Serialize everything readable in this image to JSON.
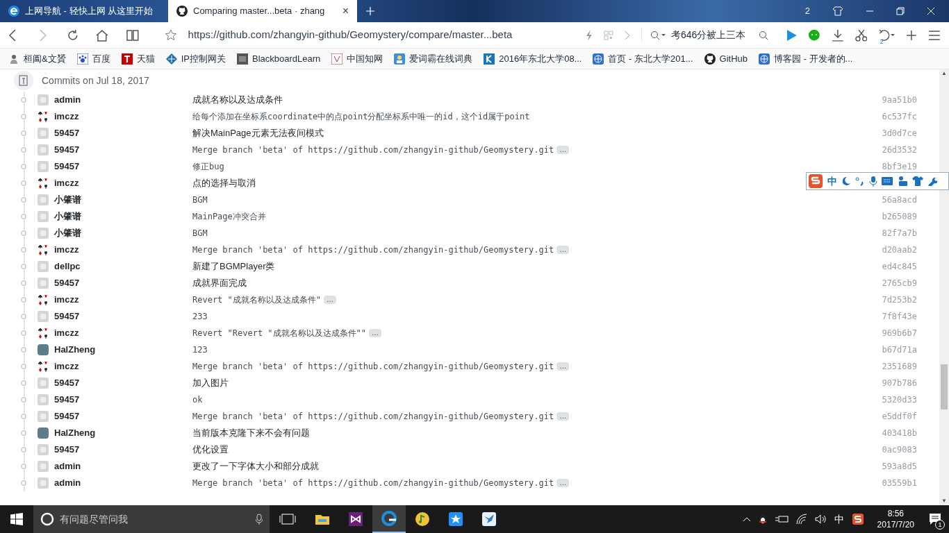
{
  "tabs": [
    {
      "label": "上网导航 - 轻快上网 从这里开始",
      "selected": false
    },
    {
      "label": "Comparing master...beta · zhang",
      "selected": true,
      "close_label": "×"
    }
  ],
  "scroll_arrows": {
    "up": "▲",
    "down": "▼"
  },
  "window_badge": "2",
  "address": {
    "url": "https://github.com/zhangyin-github/Geomystery/compare/master...beta",
    "search": "考646分被上三本",
    "undo_count": "2"
  },
  "bookmarks": [
    {
      "label": "桓阖&文贇",
      "kind": "person"
    },
    {
      "label": "百度",
      "kind": "paw"
    },
    {
      "label": "天猫",
      "kind": "t"
    },
    {
      "label": "IP控制网关",
      "kind": "diamond"
    },
    {
      "label": "BlackboardLearn",
      "kind": "bb"
    },
    {
      "label": "中国知网",
      "kind": "zhi"
    },
    {
      "label": "爱词霸在线词典",
      "kind": "ciba"
    },
    {
      "label": "2016年东北大学08...",
      "kind": "k"
    },
    {
      "label": "首页 - 东北大学201...",
      "kind": "globe"
    },
    {
      "label": "GitHub",
      "kind": "github"
    },
    {
      "label": "博客园 - 开发者的...",
      "kind": "globe"
    }
  ],
  "commit_group": {
    "title": "Commits on Jul 18, 2017",
    "commits": [
      {
        "author": "admin",
        "kind": "default",
        "message": "成就名称以及达成条件",
        "mono": false,
        "sha": "9aa51b0"
      },
      {
        "author": "imczz",
        "kind": "cards",
        "message": "给每个添加在坐标系coordinate中的点point分配坐标系中唯一的id，这个id属于point",
        "mono": true,
        "sha": "6c537fc"
      },
      {
        "author": "59457",
        "kind": "default",
        "message": "解决MainPage元素无法夜间模式",
        "mono": false,
        "sha": "3d0d7ce"
      },
      {
        "author": "59457",
        "kind": "default",
        "message": "Merge branch 'beta' of https://github.com/zhangyin-github/Geomystery.git",
        "mono": true,
        "expander": "…",
        "sha": "26d3532"
      },
      {
        "author": "59457",
        "kind": "default",
        "message": "修正bug",
        "mono": true,
        "sha": "8bf3e19"
      },
      {
        "author": "imczz",
        "kind": "cards",
        "message": "点的选择与取消",
        "mono": false
      },
      {
        "author": "小肇谱",
        "kind": "default",
        "message": "BGM",
        "mono": true,
        "sha": "56a8acd"
      },
      {
        "author": "小肇谱",
        "kind": "default",
        "message": "MainPage冲突合并",
        "mono": true,
        "sha": "b265089"
      },
      {
        "author": "小肇谱",
        "kind": "default",
        "message": "BGM",
        "mono": true,
        "sha": "82f7a7b"
      },
      {
        "author": "imczz",
        "kind": "cards",
        "message": "Merge branch 'beta' of https://github.com/zhangyin-github/Geomystery.git",
        "mono": true,
        "expander": "…",
        "sha": "d20aab2"
      },
      {
        "author": "dellpc",
        "kind": "default",
        "message": "新建了BGMPlayer类",
        "mono": false,
        "sha": "ed4c845"
      },
      {
        "author": "59457",
        "kind": "default",
        "message": "成就界面完成",
        "mono": false,
        "sha": "2765cb9"
      },
      {
        "author": "imczz",
        "kind": "cards",
        "message": "Revert \"成就名称以及达成条件\"",
        "mono": true,
        "expander": "…",
        "sha": "7d253b2"
      },
      {
        "author": "59457",
        "kind": "default",
        "message": "233",
        "mono": true,
        "sha": "7f8f43e"
      },
      {
        "author": "imczz",
        "kind": "cards",
        "message": "Revert \"Revert \"成就名称以及达成条件\"\"",
        "mono": true,
        "expander": "…",
        "sha": "969b6b7"
      },
      {
        "author": "HalZheng",
        "kind": "photo",
        "message": "123",
        "mono": true,
        "sha": "b67d71a"
      },
      {
        "author": "imczz",
        "kind": "cards",
        "message": "Merge branch 'beta' of https://github.com/zhangyin-github/Geomystery.git",
        "mono": true,
        "expander": "…",
        "sha": "2351689"
      },
      {
        "author": "59457",
        "kind": "default",
        "message": "加入图片",
        "mono": false,
        "sha": "907b786"
      },
      {
        "author": "59457",
        "kind": "default",
        "message": "ok",
        "mono": true,
        "sha": "5320d33"
      },
      {
        "author": "59457",
        "kind": "default",
        "message": "Merge branch 'beta' of https://github.com/zhangyin-github/Geomystery.git",
        "mono": true,
        "expander": "…",
        "sha": "e5ddf0f"
      },
      {
        "author": "HalZheng",
        "kind": "photo",
        "message": "当前版本克隆下来不会有问题",
        "mono": false,
        "sha": "403418b"
      },
      {
        "author": "59457",
        "kind": "default",
        "message": "优化设置",
        "mono": false,
        "sha": "0ac9083"
      },
      {
        "author": "admin",
        "kind": "default",
        "message": "更改了一下字体大小和部分成就",
        "mono": false,
        "sha": "593a8d5"
      },
      {
        "author": "admin",
        "kind": "default",
        "message": "Merge branch 'beta' of https://github.com/zhangyin-github/Geomystery.git",
        "mono": true,
        "expander": "…",
        "sha": "03559b1"
      }
    ]
  },
  "ime_toolbar": {
    "mode": "中"
  },
  "taskbar": {
    "search_placeholder": "有问题尽管问我",
    "apps": [
      {
        "kind": "folder",
        "active": false
      },
      {
        "kind": "vs",
        "active": false
      },
      {
        "kind": "browser",
        "active": true
      },
      {
        "kind": "music",
        "active": false
      },
      {
        "kind": "star",
        "active": false
      },
      {
        "kind": "bird",
        "active": false
      }
    ],
    "input_mode": "中",
    "time": "8:56",
    "date": "2017/7/20",
    "notification_count": "1"
  }
}
